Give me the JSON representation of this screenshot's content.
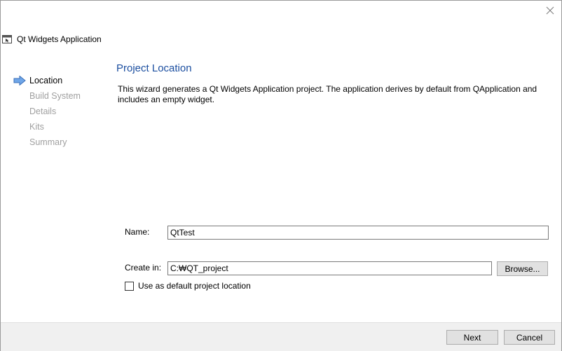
{
  "window": {
    "title": "Qt Widgets Application",
    "icons": {
      "app": "qt-app-window-icon",
      "close": "close-icon"
    }
  },
  "steps": [
    {
      "label": "Location",
      "active": true
    },
    {
      "label": "Build System",
      "active": false
    },
    {
      "label": "Details",
      "active": false
    },
    {
      "label": "Kits",
      "active": false
    },
    {
      "label": "Summary",
      "active": false
    }
  ],
  "page": {
    "title": "Project Location",
    "description": "This wizard generates a Qt Widgets Application project. The application derives by default from QApplication and includes an empty widget."
  },
  "form": {
    "name_label": "Name:",
    "name_value": "QtTest",
    "create_in_label": "Create in:",
    "create_in_value": "C:₩QT_project",
    "browse_label": "Browse...",
    "default_location_label": "Use as default project location",
    "default_location_checked": false
  },
  "buttons": {
    "next": "Next",
    "cancel": "Cancel"
  },
  "colors": {
    "page_title": "#1c4fa0",
    "inactive_step": "#a0a0a0",
    "active_arrow": "#3a7bd5",
    "footer_bg": "#f0f0f0"
  }
}
